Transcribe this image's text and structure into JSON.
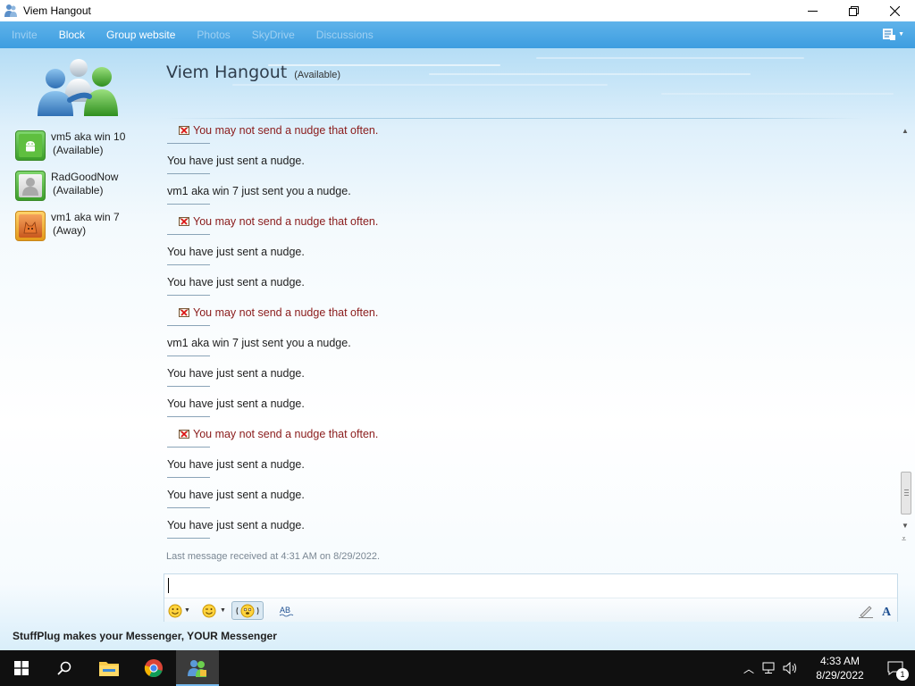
{
  "window": {
    "title": "Viem Hangout"
  },
  "menu": {
    "items": [
      {
        "label": "Invite",
        "enabled": false
      },
      {
        "label": "Block",
        "enabled": true
      },
      {
        "label": "Group website",
        "enabled": true
      },
      {
        "label": "Photos",
        "enabled": false
      },
      {
        "label": "SkyDrive",
        "enabled": false
      },
      {
        "label": "Discussions",
        "enabled": false
      }
    ]
  },
  "conversation": {
    "title": "Viem Hangout",
    "status": "(Available)"
  },
  "contacts": [
    {
      "name": "vm5 aka win 10",
      "status": "(Available)",
      "presence": "available",
      "color": "#3c9e2a"
    },
    {
      "name": "RadGoodNow",
      "status": "(Available)",
      "presence": "available",
      "color": "#3c9e2a"
    },
    {
      "name": "vm1 aka win 7",
      "status": "(Away)",
      "presence": "away",
      "color": "#e49a1a"
    }
  ],
  "messages": [
    {
      "text": "You may not send a nudge that often.",
      "type": "warning"
    },
    {
      "text": "You have just sent a nudge.",
      "type": "normal"
    },
    {
      "text": "vm1 aka win 7 just sent you a nudge.",
      "type": "normal"
    },
    {
      "text": "You may not send a nudge that often.",
      "type": "warning"
    },
    {
      "text": "You have just sent a nudge.",
      "type": "normal"
    },
    {
      "text": "You have just sent a nudge.",
      "type": "normal"
    },
    {
      "text": "You may not send a nudge that often.",
      "type": "warning"
    },
    {
      "text": "vm1 aka win 7 just sent you a nudge.",
      "type": "normal"
    },
    {
      "text": "You have just sent a nudge.",
      "type": "normal"
    },
    {
      "text": "You have just sent a nudge.",
      "type": "normal"
    },
    {
      "text": "You may not send a nudge that often.",
      "type": "warning"
    },
    {
      "text": "You have just sent a nudge.",
      "type": "normal"
    },
    {
      "text": "You have just sent a nudge.",
      "type": "normal"
    },
    {
      "text": "You have just sent a nudge.",
      "type": "normal"
    }
  ],
  "last_message": "Last message received at 4:31 AM on 8/29/2022.",
  "input": {
    "value": ""
  },
  "footer": {
    "text": "StuffPlug makes your Messenger, YOUR Messenger"
  },
  "taskbar": {
    "pinned": [
      "windows-start-icon",
      "search-icon",
      "file-explorer-icon",
      "chrome-icon",
      "messenger-icon"
    ],
    "clock_time": "4:33 AM",
    "clock_date": "8/29/2022",
    "notification_count": "1"
  },
  "colors": {
    "menubar": "#3d9de0",
    "warning_text": "#8a1b1b",
    "taskbar": "#101010",
    "accent": "#76b9ed"
  }
}
